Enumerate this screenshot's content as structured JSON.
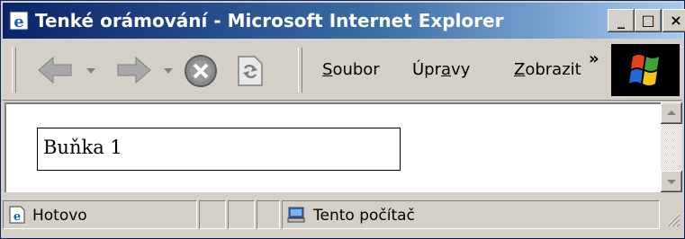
{
  "window": {
    "title": "Tenké orámování - Microsoft Internet Explorer"
  },
  "window_controls": {
    "minimize": "_",
    "maximize": "□",
    "close": "×"
  },
  "toolbar": {
    "menu": [
      {
        "label_pre": "",
        "label_ul": "S",
        "label_post": "oubor"
      },
      {
        "label_pre": "Úpr",
        "label_ul": "a",
        "label_post": "vy"
      },
      {
        "label_pre": "",
        "label_ul": "Z",
        "label_post": "obrazit"
      }
    ],
    "chevron": "»",
    "icons": [
      "back-arrow-icon",
      "dropdown-arrow-icon",
      "forward-arrow-icon",
      "stop-icon",
      "refresh-icon",
      "windows-logo-icon"
    ]
  },
  "page": {
    "cell_text": "Buňka 1"
  },
  "status": {
    "text": "Hotovo",
    "zone": "Tento počítač"
  },
  "colors": {
    "title_start": "#0a246a",
    "title_end": "#a6caf0",
    "chrome": "#d4d0c8"
  }
}
